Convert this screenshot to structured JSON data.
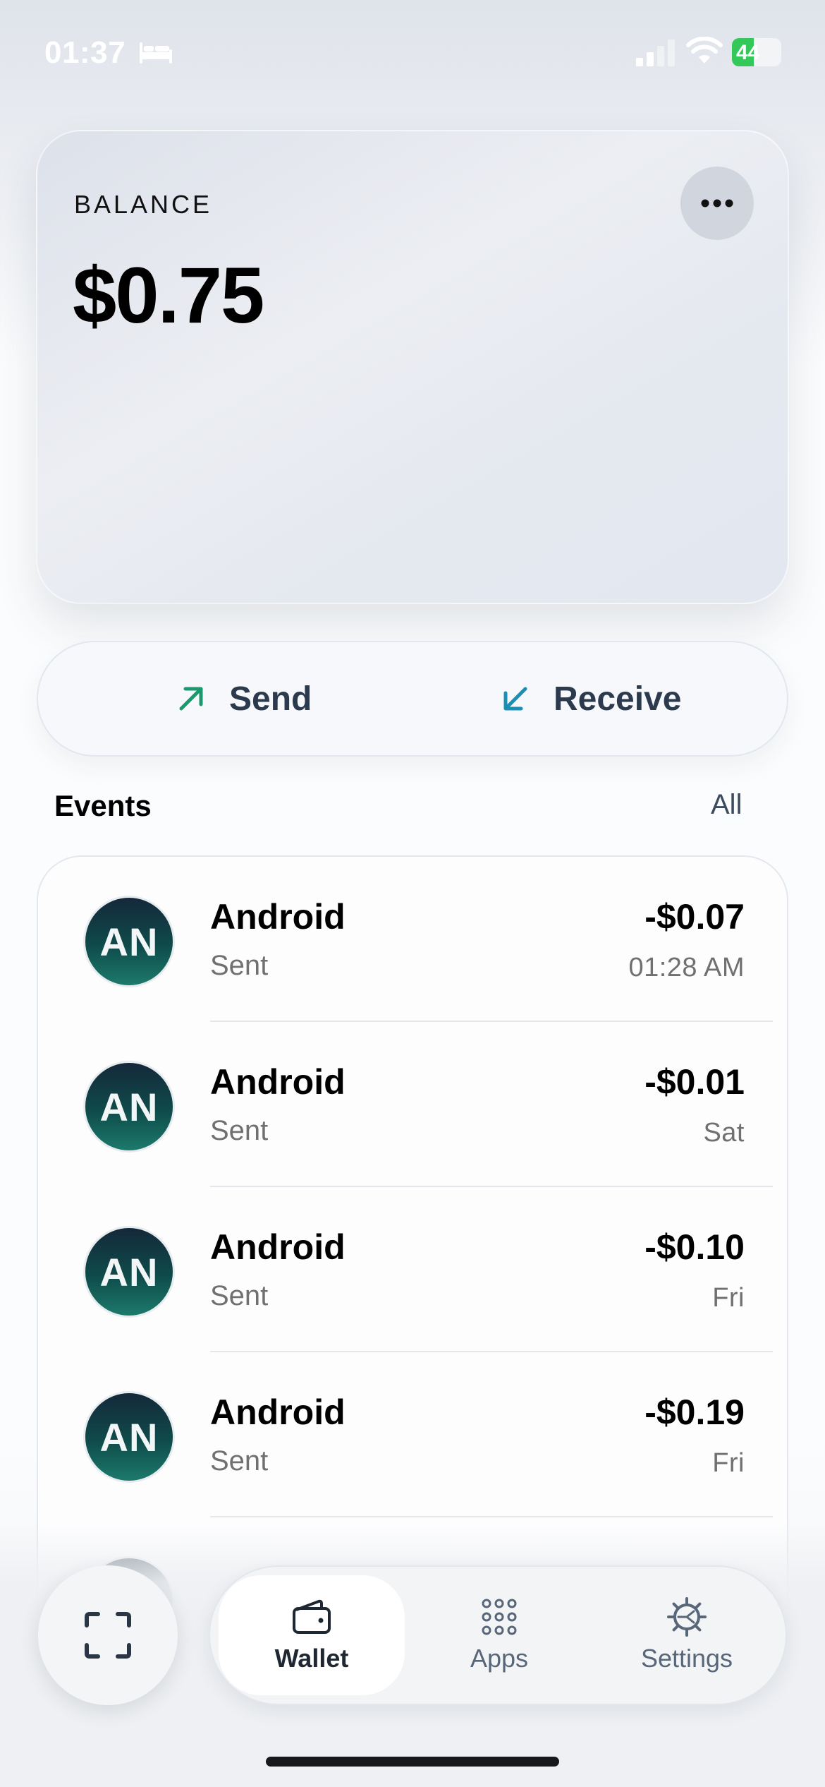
{
  "status_bar": {
    "time": "01:37",
    "battery_level": "44",
    "battery_percent": 44,
    "focus_icon": "bed-icon"
  },
  "balance": {
    "label": "BALANCE",
    "amount": "$0.75",
    "menu_icon": "more-horizontal-icon"
  },
  "actions": {
    "send_label": "Send",
    "send_icon": "arrow-up-right-icon",
    "send_color": "#1a9a6c",
    "receive_label": "Receive",
    "receive_icon": "arrow-down-left-icon",
    "receive_color": "#1b8fb3"
  },
  "events": {
    "title": "Events",
    "all_label": "All",
    "items": [
      {
        "initials": "AN",
        "name": "Android",
        "status": "Sent",
        "amount": "-$0.07",
        "time": "01:28 AM"
      },
      {
        "initials": "AN",
        "name": "Android",
        "status": "Sent",
        "amount": "-$0.01",
        "time": "Sat"
      },
      {
        "initials": "AN",
        "name": "Android",
        "status": "Sent",
        "amount": "-$0.10",
        "time": "Fri"
      },
      {
        "initials": "AN",
        "name": "Android",
        "status": "Sent",
        "amount": "-$0.19",
        "time": "Fri"
      }
    ]
  },
  "nav": {
    "scan_icon": "scan-icon",
    "tabs": [
      {
        "label": "Wallet",
        "icon": "wallet-icon",
        "active": true
      },
      {
        "label": "Apps",
        "icon": "apps-grid-icon",
        "active": false
      },
      {
        "label": "Settings",
        "icon": "gear-icon",
        "active": false
      }
    ]
  }
}
